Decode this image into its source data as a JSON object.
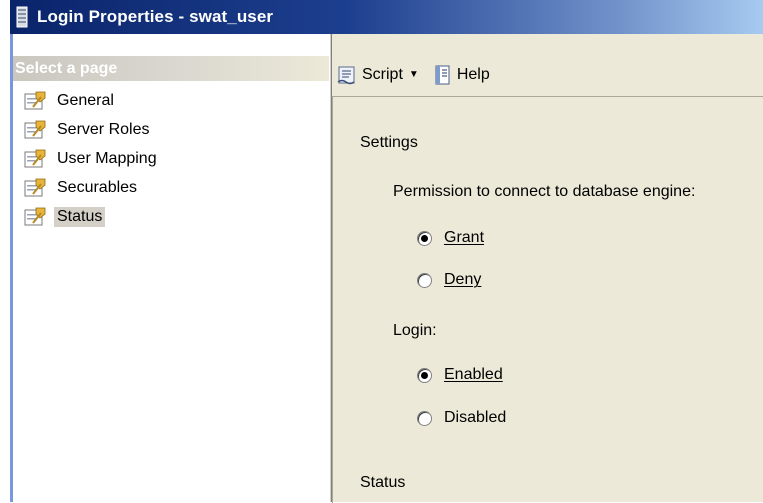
{
  "window": {
    "title": "Login Properties - swat_user"
  },
  "left_pane": {
    "header": "Select a page",
    "pages": [
      {
        "label": "General"
      },
      {
        "label": "Server Roles"
      },
      {
        "label": "User Mapping"
      },
      {
        "label": "Securables"
      },
      {
        "label": "Status",
        "selected": true
      }
    ]
  },
  "toolbar": {
    "script_label": "Script",
    "help_label": "Help"
  },
  "settings": {
    "section_label": "Settings",
    "permission_label": "Permission to connect to database engine:",
    "grant_label": "Grant",
    "deny_label": "Deny",
    "grant_checked": true,
    "login_label": "Login:",
    "enabled_label": "Enabled",
    "disabled_label": "Disabled",
    "enabled_checked": true,
    "status_section_label": "Status"
  },
  "colors": {
    "titlebar_start": "#0a246a",
    "titlebar_end": "#a6caf0",
    "panel_bg": "#ece9d8",
    "selected_item_bg": "#d4d0c8"
  }
}
